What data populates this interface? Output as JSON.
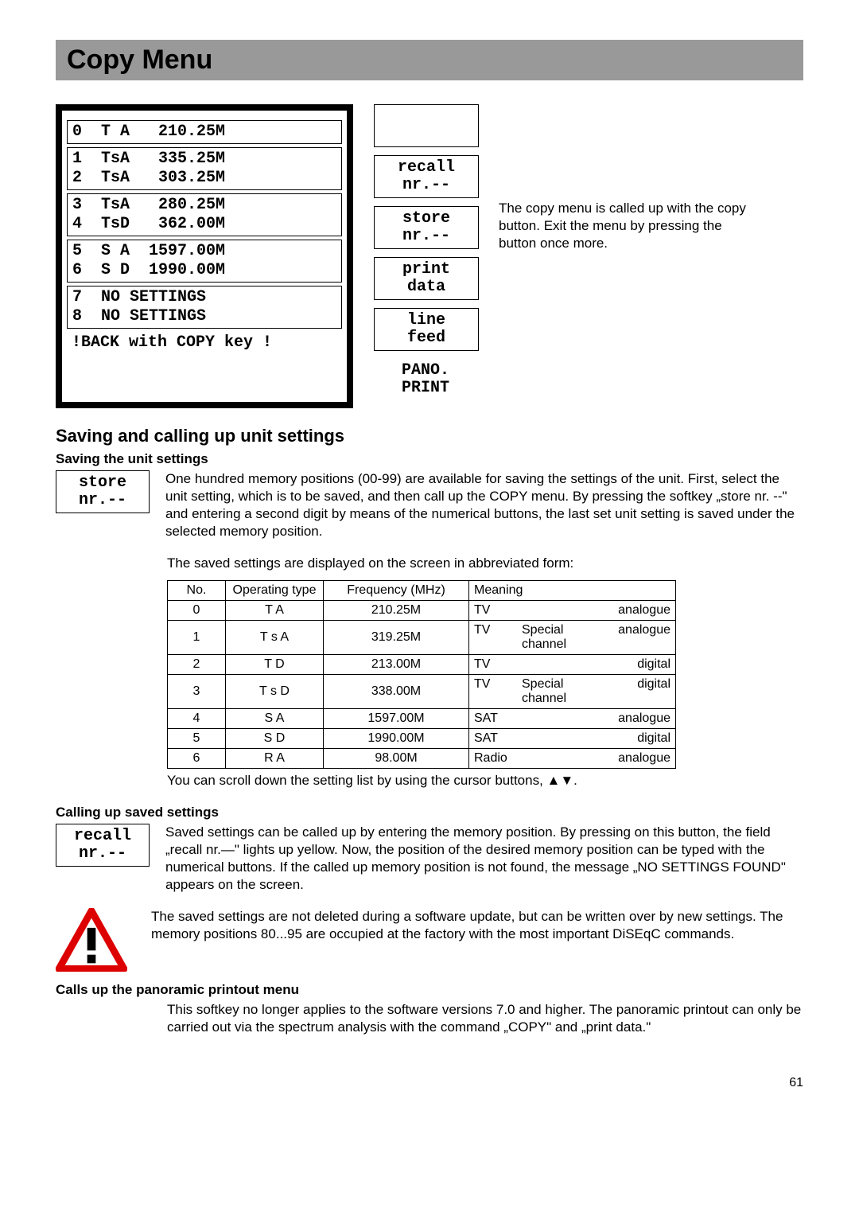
{
  "title": "Copy Menu",
  "lcd": {
    "groups": [
      [
        "0  T A   210.25M"
      ],
      [
        "1  TsA   335.25M",
        "2  TsA   303.25M"
      ],
      [
        "3  TsA   280.25M",
        "4  TsD   362.00M"
      ],
      [
        "5  S A  1597.00M",
        "6  S D  1990.00M"
      ],
      [
        "7  NO SETTINGS",
        "8  NO SETTINGS"
      ]
    ],
    "bottom": "!BACK with COPY key !"
  },
  "softkeys": [
    {
      "l1": "",
      "l2": ""
    },
    {
      "l1": "recall",
      "l2": "nr.--"
    },
    {
      "l1": "store",
      "l2": "nr.--"
    },
    {
      "l1": "print",
      "l2": "data"
    },
    {
      "l1": "line",
      "l2": "feed"
    },
    {
      "l1": "PANO.",
      "l2": "PRINT"
    }
  ],
  "side_note": "The copy menu is called up with the copy button. Exit the menu by pressing the button once more.",
  "subhead1": "Saving and calling up unit settings",
  "saving_label": "Saving the unit settings",
  "store_box_l1": "store",
  "store_box_l2": "nr.--",
  "saving_text": "One hundred memory positions (00-99) are available for saving the settings of the unit. First, select the unit setting, which is to be saved, and then call up the COPY menu. By pressing the softkey „store nr. --\" and entering a second digit by means of the numerical buttons, the last set unit setting is saved under the selected memory position.",
  "saved_displayed": "The saved settings are displayed on the screen in abbreviated form:",
  "table": {
    "headers": [
      "No.",
      "Operating type",
      "Frequency (MHz)",
      "Meaning"
    ],
    "rows": [
      {
        "no": "0",
        "op": "T A",
        "freq": "210.25M",
        "m1": "TV",
        "m2": "",
        "m3": "analogue"
      },
      {
        "no": "1",
        "op": "T s A",
        "freq": "319.25M",
        "m1": "TV",
        "m2": "Special channel",
        "m3": "analogue"
      },
      {
        "no": "2",
        "op": "T D",
        "freq": "213.00M",
        "m1": "TV",
        "m2": "",
        "m3": "digital"
      },
      {
        "no": "3",
        "op": "T s D",
        "freq": "338.00M",
        "m1": "TV",
        "m2": "Special channel",
        "m3": "digital"
      },
      {
        "no": "4",
        "op": "S A",
        "freq": "1597.00M",
        "m1": "SAT",
        "m2": "",
        "m3": "analogue"
      },
      {
        "no": "5",
        "op": "S D",
        "freq": "1990.00M",
        "m1": "SAT",
        "m2": "",
        "m3": "digital"
      },
      {
        "no": "6",
        "op": "R A",
        "freq": "98.00M",
        "m1": "Radio",
        "m2": "",
        "m3": "analogue"
      }
    ]
  },
  "scroll_note": "You can scroll down the setting list by using the cursor buttons, ▲▼.",
  "calling_label": "Calling up saved settings",
  "recall_box_l1": "recall",
  "recall_box_l2": "nr.--",
  "calling_text": "Saved settings can be called up by entering the memory position.  By pressing on this button, the field „recall nr.—\" lights up yellow. Now, the position of the desired memory position can be typed with the numerical buttons. If the called up memory position is not found, the message  „NO SETTINGS FOUND\" appears on the screen.",
  "warning_text": "The saved settings are not deleted during a software update, but can be written over by new settings. The memory positions 80...95 are occupied at the factory with the most important DiSEqC commands.",
  "pano_label": "Calls up the panoramic printout menu",
  "pano_text": "This softkey no longer applies to the software versions 7.0 and higher. The panoramic printout can only be carried out via the spectrum analysis with the command „COPY\" and „print data.\"",
  "page_number": "61"
}
